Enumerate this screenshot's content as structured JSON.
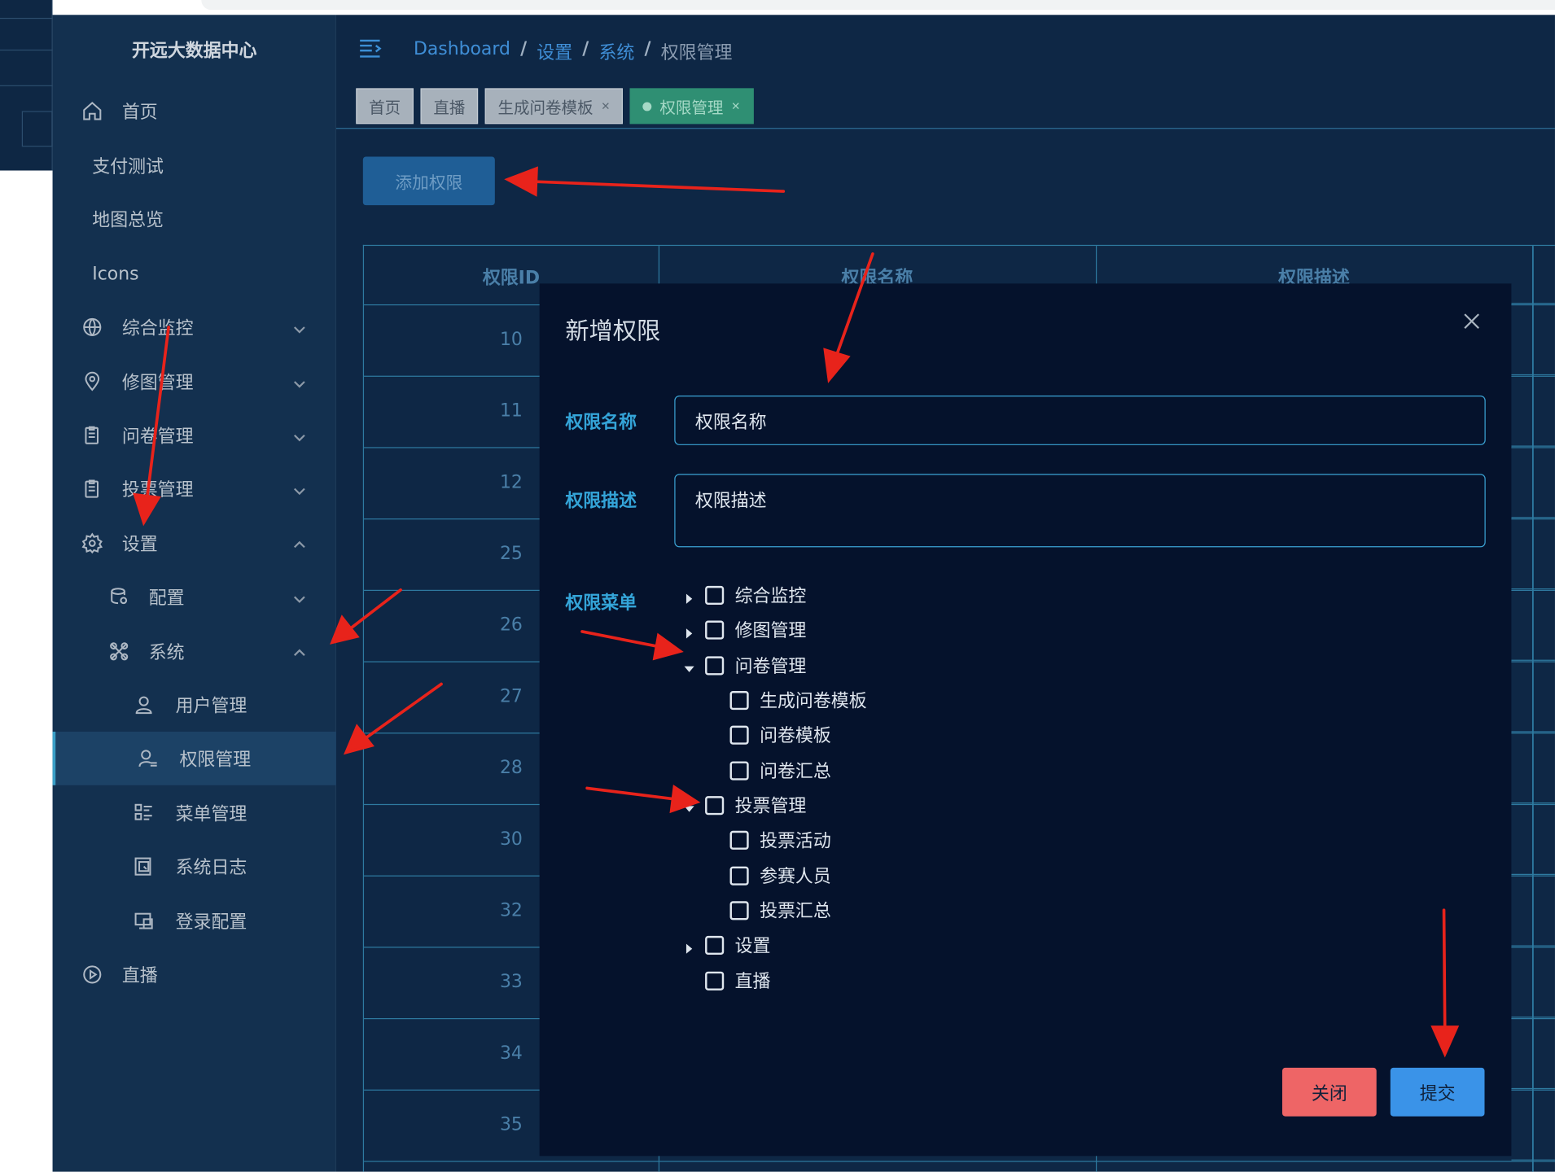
{
  "app": {
    "logo_text": "开远大数据中心"
  },
  "sidebar": {
    "items": [
      {
        "label": "首页",
        "icon": "home-icon"
      },
      {
        "label": "支付测试"
      },
      {
        "label": "地图总览"
      },
      {
        "label": "Icons"
      },
      {
        "label": "综合监控",
        "icon": "globe-icon"
      },
      {
        "label": "修图管理",
        "icon": "location-icon"
      },
      {
        "label": "问卷管理",
        "icon": "clipboard-icon"
      },
      {
        "label": "投票管理",
        "icon": "clipboard-icon"
      },
      {
        "label": "设置",
        "icon": "gear-icon"
      },
      {
        "label": "配置",
        "icon": "config-icon"
      },
      {
        "label": "系统",
        "icon": "tools-icon"
      },
      {
        "label": "用户管理",
        "icon": "user-icon"
      },
      {
        "label": "权限管理",
        "icon": "user-permission-icon"
      },
      {
        "label": "菜单管理",
        "icon": "menu-list-icon"
      },
      {
        "label": "系统日志",
        "icon": "log-icon"
      },
      {
        "label": "登录配置",
        "icon": "login-config-icon"
      },
      {
        "label": "直播",
        "icon": "play-circle-icon"
      }
    ]
  },
  "breadcrumb": {
    "items": [
      "Dashboard",
      "设置",
      "系统",
      "权限管理"
    ],
    "separator": "/"
  },
  "tabs": [
    {
      "label": "首页",
      "closable": false
    },
    {
      "label": "直播",
      "closable": false
    },
    {
      "label": "生成问卷模板",
      "closable": true
    },
    {
      "label": "权限管理",
      "closable": true,
      "active": true
    }
  ],
  "toolbar": {
    "add_label": "添加权限"
  },
  "table": {
    "columns": [
      "权限ID",
      "权限名称",
      "权限描述"
    ],
    "ids": [
      "10",
      "11",
      "12",
      "25",
      "26",
      "27",
      "28",
      "30",
      "32",
      "33",
      "34",
      "35"
    ]
  },
  "modal": {
    "title": "新增权限",
    "name_label": "权限名称",
    "name_value": "权限名称",
    "desc_label": "权限描述",
    "desc_value": "权限描述",
    "menu_label": "权限菜单",
    "tree": [
      {
        "label": "综合监控",
        "caret": "collapsed"
      },
      {
        "label": "修图管理",
        "caret": "collapsed"
      },
      {
        "label": "问卷管理",
        "caret": "expanded"
      },
      {
        "label": "生成问卷模板"
      },
      {
        "label": "问卷模板"
      },
      {
        "label": "问卷汇总"
      },
      {
        "label": "投票管理",
        "caret": "expanded"
      },
      {
        "label": "投票活动"
      },
      {
        "label": "参赛人员"
      },
      {
        "label": "投票汇总"
      },
      {
        "label": "设置",
        "caret": "collapsed"
      },
      {
        "label": "直播"
      }
    ],
    "close_label": "关闭",
    "submit_label": "提交"
  },
  "colors": {
    "sidebar_bg": "#13304f",
    "main_bg": "#0e2745",
    "modal_bg": "#05122c",
    "accent": "#34a4d8",
    "active_tab": "#2f8f73",
    "close_btn": "#ee6566",
    "submit_btn": "#3a93e8",
    "annotation_arrow": "#e8231b"
  }
}
